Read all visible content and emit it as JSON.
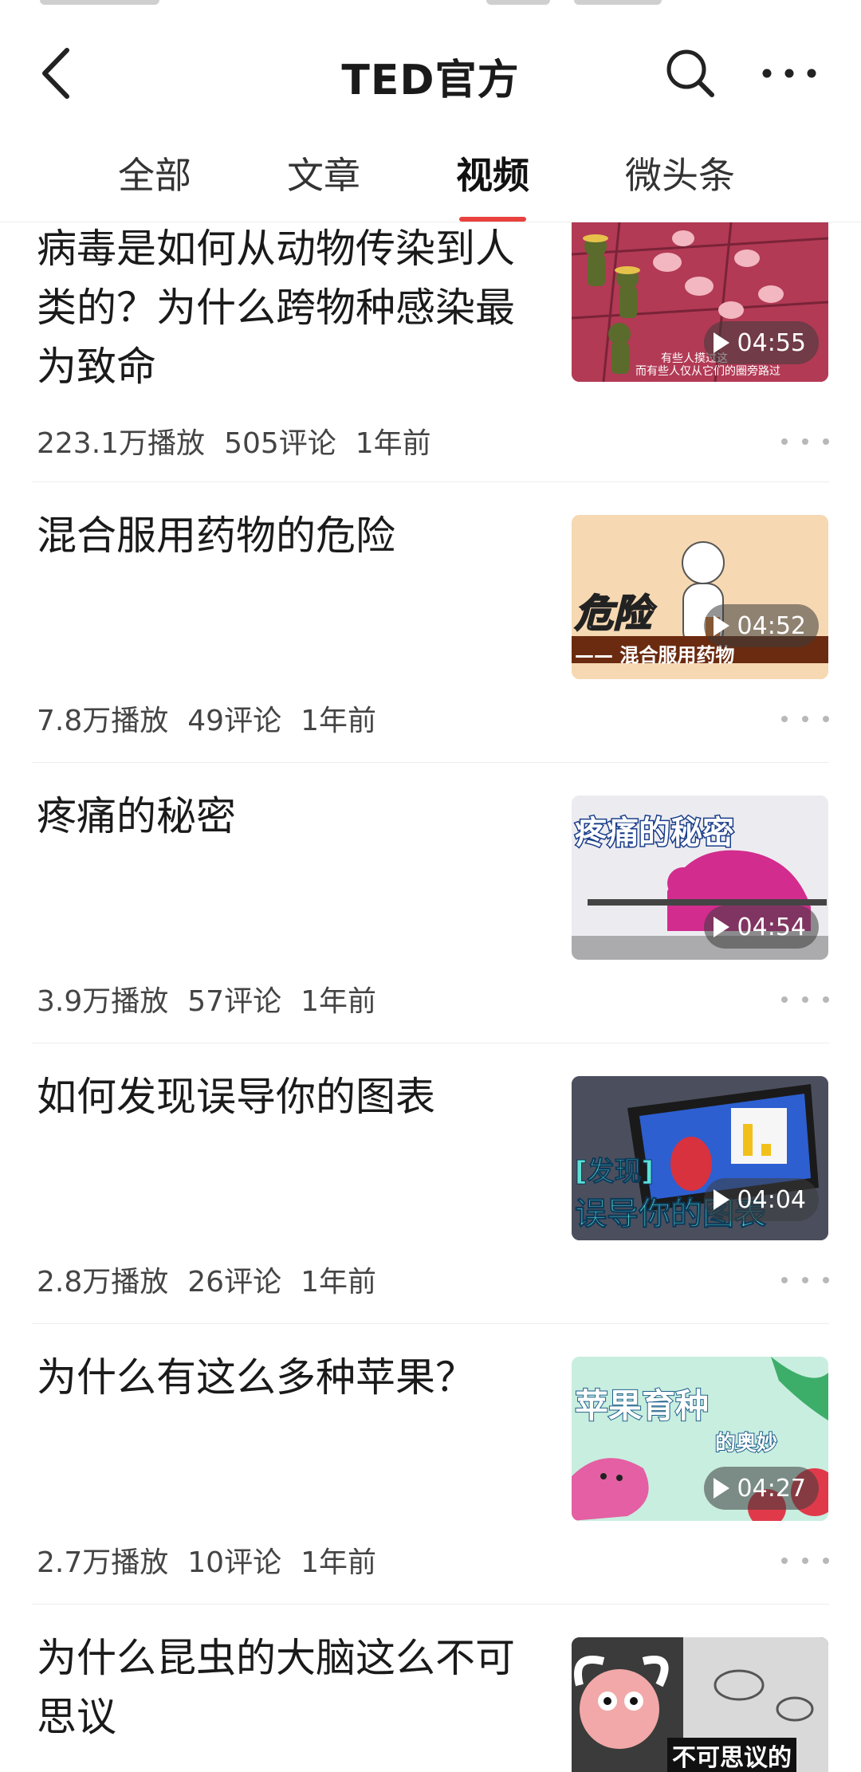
{
  "header": {
    "title": "TED官方",
    "back_icon": "chevron-left-icon",
    "search_icon": "search-icon",
    "more_icon": "more-horizontal-icon"
  },
  "tabs": [
    {
      "label": "全部",
      "active": false
    },
    {
      "label": "文章",
      "active": false
    },
    {
      "label": "视频",
      "active": true
    },
    {
      "label": "微头条",
      "active": false
    }
  ],
  "accent_color": "#e8413e",
  "videos": [
    {
      "title": "病毒是如何从动物传染到人类的？为什么跨物种感染最为致命",
      "plays": "223.1万播放",
      "comments": "505评论",
      "time": "1年前",
      "duration": "04:55",
      "thumb_caption_1": "有些人摸过这",
      "thumb_caption_2": "而有些人仅从它们的圈旁路过"
    },
    {
      "title": "混合服用药物的危险",
      "plays": "7.8万播放",
      "comments": "49评论",
      "time": "1年前",
      "duration": "04:52",
      "thumb_text_1": "危险",
      "thumb_text_2": "—— 混合服用药物"
    },
    {
      "title": "疼痛的秘密",
      "plays": "3.9万播放",
      "comments": "57评论",
      "time": "1年前",
      "duration": "04:54",
      "thumb_text_1": "疼痛的秘密"
    },
    {
      "title": "如何发现误导你的图表",
      "plays": "2.8万播放",
      "comments": "26评论",
      "time": "1年前",
      "duration": "04:04",
      "thumb_text_1": "[发现]",
      "thumb_text_2": "误导你的图表"
    },
    {
      "title": "为什么有这么多种苹果？",
      "plays": "2.7万播放",
      "comments": "10评论",
      "time": "1年前",
      "duration": "04:27",
      "thumb_text_1": "苹果育种",
      "thumb_text_2": "的奥妙"
    },
    {
      "title": "为什么昆虫的大脑这么不可思议",
      "thumb_text_1": "不可思议的"
    }
  ]
}
